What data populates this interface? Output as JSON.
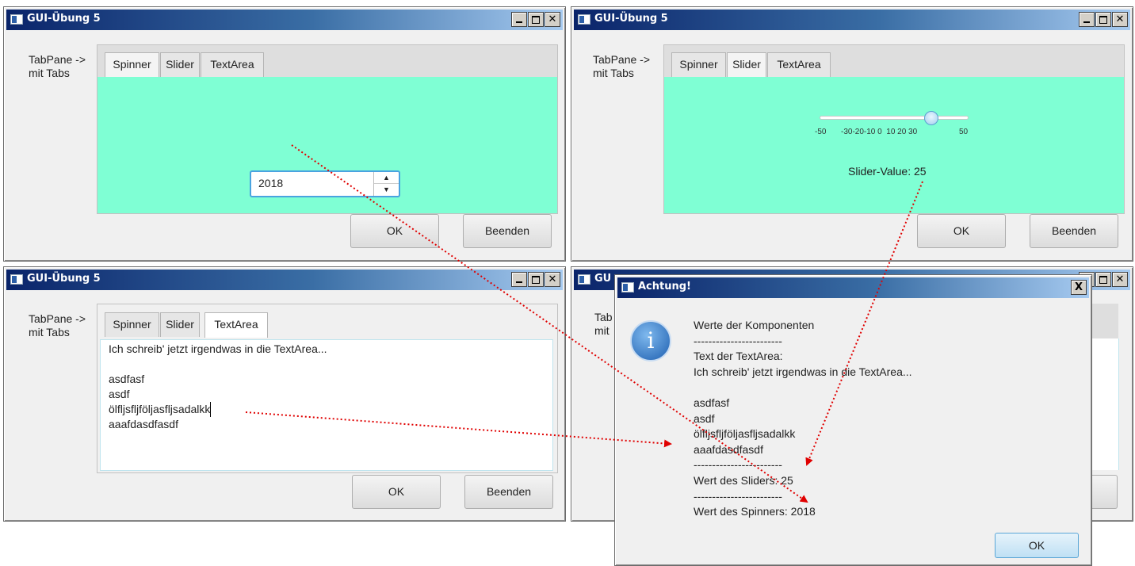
{
  "window_title": "GUI-Übung 5",
  "hint": [
    "TabPane ->",
    "mit Tabs"
  ],
  "tabs": [
    "Spinner",
    "Slider",
    "TextArea"
  ],
  "buttons": {
    "ok": "OK",
    "quit": "Beenden"
  },
  "spinner": {
    "value": "2018",
    "up_icon": "triangle-up",
    "down_icon": "triangle-down"
  },
  "slider": {
    "value": 25,
    "min": -50,
    "max": 50,
    "tick_labels": [
      "-50",
      "-30-20-10 0  10 20 30",
      "50"
    ],
    "value_label": "Slider-Value: 25"
  },
  "textarea": {
    "lines": [
      "Ich schreib' jetzt irgendwas in die TextArea...",
      "",
      "asdfasf",
      "asdf",
      "ölfljsfljföljasfljsadalkk",
      "aaafdasdfasdf"
    ]
  },
  "bg_window": {
    "title_fragment": "GU",
    "label_fragments": [
      "Tab",
      "mit"
    ],
    "quit_fragment": "n"
  },
  "dialog": {
    "title": "Achtung!",
    "close_label": "X",
    "icon": "info-icon",
    "icon_glyph": "i",
    "lines": [
      "Werte der Komponenten",
      "------------------------",
      "Text der TextArea:",
      "Ich schreib' jetzt irgendwas in die TextArea...",
      "",
      "asdfasf",
      "asdf",
      "ölfljsfljföljasfljsadalkk",
      "aaafdasdfasdf",
      "------------------------",
      "Wert des Sliders: 25",
      "------------------------",
      "Wert des Spinners: 2018"
    ],
    "ok_label": "OK"
  },
  "colors": {
    "content_green": "#7FFFD4",
    "arrow": "#E00000",
    "accent": "#3A6EA5"
  }
}
